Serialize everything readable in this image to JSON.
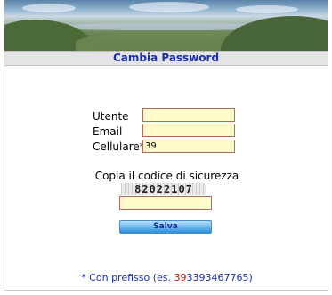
{
  "header": {
    "title": "Cambia Password"
  },
  "form": {
    "utente_label": "Utente",
    "email_label": "Email",
    "cellulare_label": "Cellulare*",
    "utente_value": "",
    "email_value": "",
    "cellulare_value": "39"
  },
  "captcha": {
    "title": "Copia il codice di sicurezza",
    "code": "82022107",
    "input_value": ""
  },
  "buttons": {
    "save_label": "Salva"
  },
  "footer": {
    "note_prefix": "* Con prefisso (es. ",
    "note_example_prefix": "39",
    "note_example_number": "3393467765",
    "note_suffix": ")"
  },
  "colors": {
    "title_text": "#1a2fae",
    "input_bg": "#fffbcb",
    "input_border": "#b06a60",
    "button_blue": "#61b4ef",
    "example_red": "#d01010"
  }
}
